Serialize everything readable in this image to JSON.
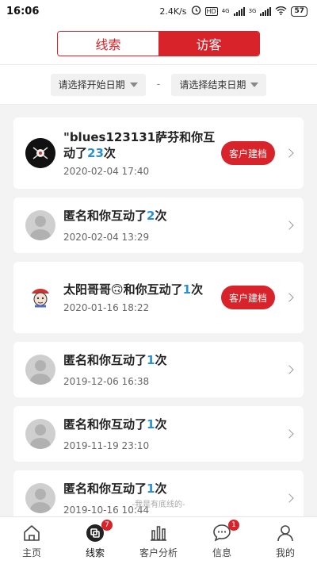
{
  "status_bar": {
    "time": "16:06",
    "speed": "2.4K/s",
    "net1": "4G",
    "net2": "3G",
    "battery": "57",
    "hd": "HD"
  },
  "segment": {
    "tabs": [
      {
        "label": "线索",
        "active": false
      },
      {
        "label": "访客",
        "active": true
      }
    ]
  },
  "filters": {
    "start_date": "请选择开始日期",
    "separator": "-",
    "end_date": "请选择结束日期"
  },
  "visitors": [
    {
      "name_prefix": "\"blues123131萨芬和你互动了",
      "count": "23",
      "suffix": "次",
      "time": "2020-02-04 17:40",
      "avatar": "dark-avatar",
      "action": "客户建档"
    },
    {
      "name_prefix": "匿名和你互动了",
      "count": "2",
      "suffix": "次",
      "time": "2020-02-04 13:29",
      "avatar": "default-avatar",
      "action": ""
    },
    {
      "name_prefix": "太阳哥哥🙃和你互动了",
      "count": "1",
      "suffix": "次",
      "time": "2020-01-16 18:22",
      "avatar": "cartoon-avatar",
      "action": "客户建档"
    },
    {
      "name_prefix": "匿名和你互动了",
      "count": "1",
      "suffix": "次",
      "time": "2019-12-06 16:38",
      "avatar": "default-avatar",
      "action": ""
    },
    {
      "name_prefix": "匿名和你互动了",
      "count": "1",
      "suffix": "次",
      "time": "2019-11-19 23:10",
      "avatar": "default-avatar",
      "action": ""
    },
    {
      "name_prefix": "匿名和你互动了",
      "count": "1",
      "suffix": "次",
      "time": "2019-10-16 10:44",
      "avatar": "default-avatar",
      "action": ""
    }
  ],
  "footer_note": "-我是有底线的-",
  "tabbar": {
    "items": [
      {
        "label": "主页",
        "icon": "home-icon",
        "badge": ""
      },
      {
        "label": "线索",
        "icon": "clue-icon",
        "badge": "7"
      },
      {
        "label": "客户分析",
        "icon": "bar-chart-icon",
        "badge": ""
      },
      {
        "label": "信息",
        "icon": "message-icon",
        "badge": "1"
      },
      {
        "label": "我的",
        "icon": "user-icon",
        "badge": ""
      }
    ]
  },
  "colors": {
    "accent": "#d8232a",
    "count_blue": "#2b8fd6"
  }
}
